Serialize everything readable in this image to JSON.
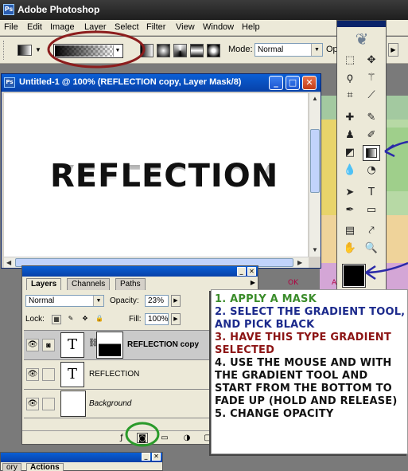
{
  "app": {
    "title": "Adobe Photoshop",
    "icon": "Ps"
  },
  "menu": [
    "File",
    "Edit",
    "Image",
    "Layer",
    "Select",
    "Filter",
    "View",
    "Window",
    "Help"
  ],
  "options_bar": {
    "mode_label": "Mode:",
    "mode_value": "Normal",
    "opacity_label_partial": "Op"
  },
  "document": {
    "title": "Untitled-1 @ 100% (REFLECTION copy, Layer Mask/8)",
    "text": "REFLECTION",
    "win_min": "_",
    "win_max": "□",
    "win_close": "✕"
  },
  "map_labels": [
    "OK",
    "AR"
  ],
  "layers_palette": {
    "tabs": [
      "Layers",
      "Channels",
      "Paths"
    ],
    "blend_mode": "Normal",
    "opacity_label": "Opacity:",
    "opacity_value": "23%",
    "lock_label": "Lock:",
    "fill_label": "Fill:",
    "fill_value": "100%",
    "layers": [
      {
        "name": "REFLECTION copy",
        "thumb": "T",
        "selected": true
      },
      {
        "name": "REFLECTION",
        "thumb": "T",
        "selected": false
      },
      {
        "name": "Background",
        "thumb": "",
        "selected": false
      }
    ]
  },
  "lower_palette": {
    "tabs": [
      "ory",
      "Actions"
    ]
  },
  "instructions": {
    "steps": [
      {
        "text": "1. APPLY A MASK",
        "color": "#3a8c2a"
      },
      {
        "text": "2. SELECT THE GRADIENT TOOL, AND PICK BLACK",
        "color": "#1c2a8c"
      },
      {
        "text": "3. HAVE THIS TYPE GRADIENT SELECTED",
        "color": "#8c1414"
      },
      {
        "text": "4. USE THE MOUSE AND WITH THE GRADIENT TOOL AND START FROM THE BOTTOM TO FADE UP (HOLD AND RELEASE)",
        "color": "#111111"
      },
      {
        "text": "5. CHANGE OPACITY",
        "color": "#111111"
      }
    ]
  },
  "colors": {
    "annotation_red": "#8c1d1d",
    "annotation_blue": "#2a2aa8",
    "annotation_green": "#2a9a2a",
    "foreground_color": "#000000"
  }
}
